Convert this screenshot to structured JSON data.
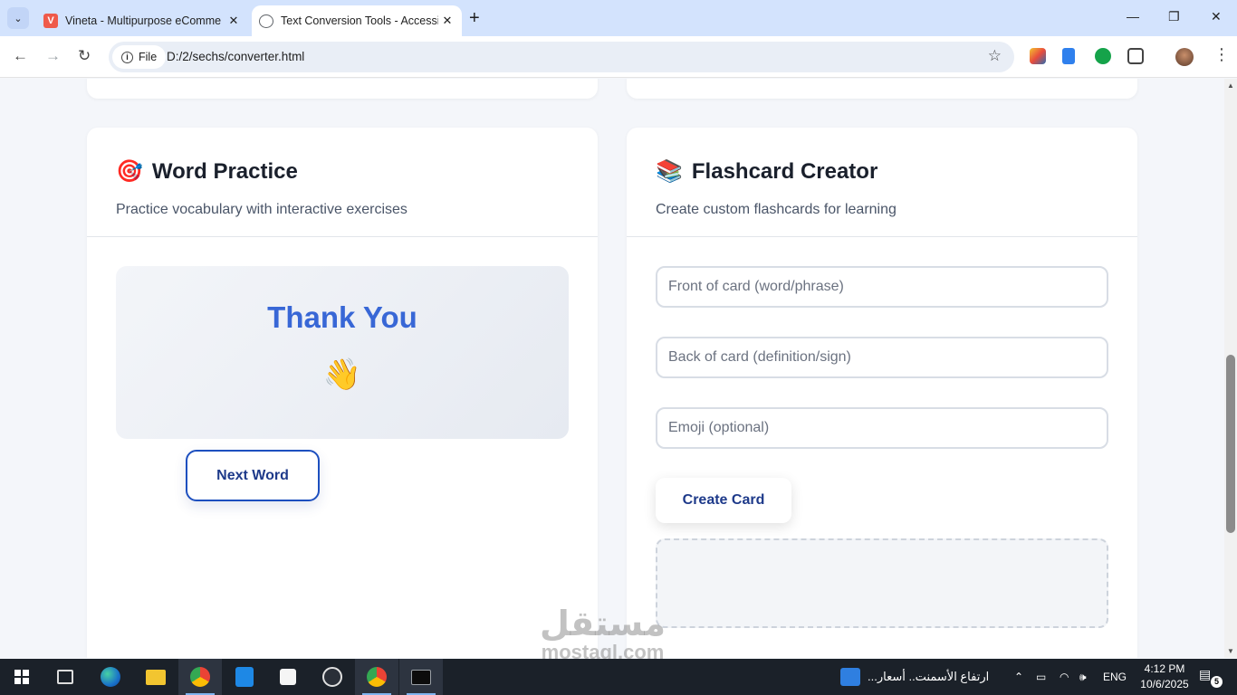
{
  "browser": {
    "tabs": [
      {
        "title": "Vineta - Multipurpose eComme",
        "favicon": "V",
        "active": false
      },
      {
        "title": "Text Conversion Tools - Accessi",
        "favicon": "",
        "active": true
      }
    ],
    "new_tab_label": "+",
    "address": {
      "chip": "File",
      "url": "D:/2/sechs/converter.html"
    },
    "window_controls": {
      "minimize": "—",
      "restore": "❐",
      "close": "✕"
    }
  },
  "word_practice": {
    "icon": "🎯",
    "title": "Word Practice",
    "subtitle": "Practice vocabulary with interactive exercises",
    "current_word": "Thank You",
    "current_emoji": "👋",
    "next_button": "Next Word"
  },
  "flashcard": {
    "icon": "📚",
    "title": "Flashcard Creator",
    "subtitle": "Create custom flashcards for learning",
    "front_placeholder": "Front of card (word/phrase)",
    "back_placeholder": "Back of card (definition/sign)",
    "emoji_placeholder": "Emoji (optional)",
    "create_button": "Create Card"
  },
  "watermark": {
    "arabic": "مستقل",
    "latin": "mostaql.com"
  },
  "taskbar": {
    "news_text": "ارتفاع الأسمنت.. أسعار...",
    "language": "ENG",
    "time": "4:12 PM",
    "date": "10/6/2025",
    "notification_count": "5"
  },
  "colors": {
    "accent": "#3867d6",
    "button_text": "#1e3a8a",
    "tab_strip": "#d3e3fd"
  }
}
